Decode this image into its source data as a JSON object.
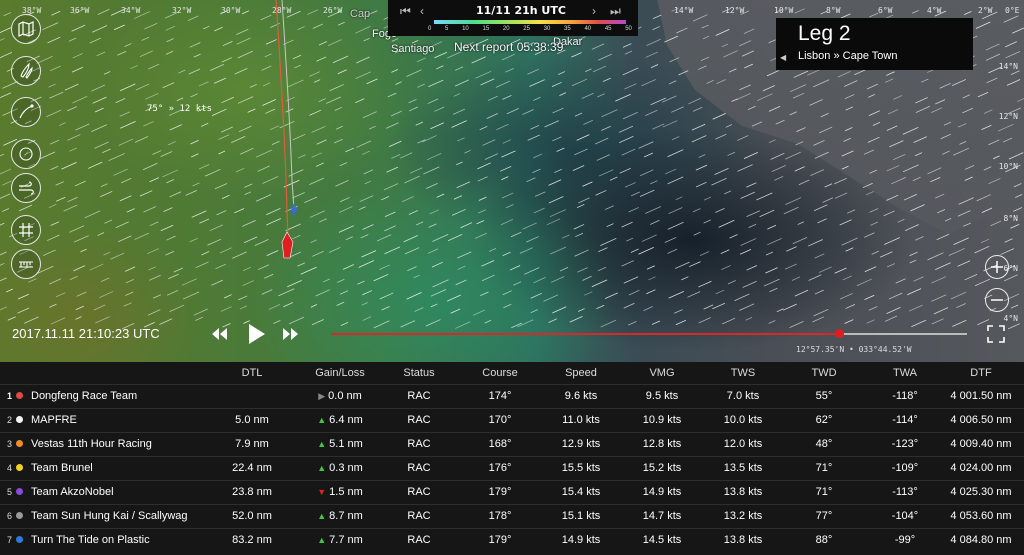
{
  "map": {
    "timebar": {
      "time": "11/11 21h UTC",
      "scale_ticks": [
        "0",
        "5",
        "10",
        "15",
        "20",
        "25",
        "30",
        "35",
        "40",
        "45",
        "50"
      ]
    },
    "places": [
      "Cap",
      "Fogo",
      "Santiago",
      "Dakar"
    ],
    "next_report": "Next report 05:38:39",
    "wind_label": "75° » 12 kts",
    "lon_labels": [
      "38°W",
      "36°W",
      "34°W",
      "32°W",
      "30°W",
      "28°W",
      "26°W",
      "14°W",
      "12°W",
      "10°W",
      "8°W",
      "6°W",
      "4°W",
      "2°W",
      "0°E"
    ],
    "lat_labels": [
      "14°N",
      "12°N",
      "10°N",
      "8°N",
      "6°N",
      "4°N"
    ],
    "leg": {
      "title": "Leg 2",
      "route": "Lisbon » Cape Town"
    },
    "tools": [
      "layers-icon",
      "sail-icon",
      "route-icon",
      "compass-icon",
      "wind-icon",
      "grid-icon",
      "ruler-icon"
    ],
    "timestamp": "2017.11.11 21:10:23 UTC",
    "timeline_progress": 0.8,
    "coords": "12°57.35'N • 033°44.52'W"
  },
  "table": {
    "headers": [
      "DTL",
      "Gain/Loss",
      "Status",
      "Course",
      "Speed",
      "VMG",
      "TWS",
      "TWD",
      "TWA",
      "DTF"
    ],
    "rows": [
      {
        "rank": "1",
        "color": "#e04848",
        "team": "Dongfeng Race Team",
        "dtl": "",
        "trend": "right",
        "gain": "0.0 nm",
        "status": "RAC",
        "course": "174°",
        "speed": "9.6 kts",
        "vmg": "9.5 kts",
        "tws": "7.0 kts",
        "twd": "55°",
        "twa": "-118°",
        "dtf": "4 001.50 nm"
      },
      {
        "rank": "2",
        "color": "#f4f4f4",
        "team": "MAPFRE",
        "dtl": "5.0 nm",
        "trend": "up",
        "gain": "6.4 nm",
        "status": "RAC",
        "course": "170°",
        "speed": "11.0 kts",
        "vmg": "10.9 kts",
        "tws": "10.0 kts",
        "twd": "62°",
        "twa": "-114°",
        "dtf": "4 006.50 nm"
      },
      {
        "rank": "3",
        "color": "#f08a2a",
        "team": "Vestas 11th Hour Racing",
        "dtl": "7.9 nm",
        "trend": "up",
        "gain": "5.1 nm",
        "status": "RAC",
        "course": "168°",
        "speed": "12.9 kts",
        "vmg": "12.8 kts",
        "tws": "12.0 kts",
        "twd": "48°",
        "twa": "-123°",
        "dtf": "4 009.40 nm"
      },
      {
        "rank": "4",
        "color": "#f4d020",
        "team": "Team Brunel",
        "dtl": "22.4 nm",
        "trend": "up",
        "gain": "0.3 nm",
        "status": "RAC",
        "course": "176°",
        "speed": "15.5 kts",
        "vmg": "15.2 kts",
        "tws": "13.5 kts",
        "twd": "71°",
        "twa": "-109°",
        "dtf": "4 024.00 nm"
      },
      {
        "rank": "5",
        "color": "#8a4ad8",
        "team": "Team AkzoNobel",
        "dtl": "23.8 nm",
        "trend": "down",
        "gain": "1.5 nm",
        "status": "RAC",
        "course": "179°",
        "speed": "15.4 kts",
        "vmg": "14.9 kts",
        "tws": "13.8 kts",
        "twd": "71°",
        "twa": "-113°",
        "dtf": "4 025.30 nm"
      },
      {
        "rank": "6",
        "color": "#9a9a9a",
        "team": "Team Sun Hung Kai / Scallywag",
        "dtl": "52.0 nm",
        "trend": "up",
        "gain": "8.7 nm",
        "status": "RAC",
        "course": "178°",
        "speed": "15.1 kts",
        "vmg": "14.7 kts",
        "tws": "13.2 kts",
        "twd": "77°",
        "twa": "-104°",
        "dtf": "4 053.60 nm"
      },
      {
        "rank": "7",
        "color": "#2a7ae0",
        "team": "Turn The Tide on Plastic",
        "dtl": "83.2 nm",
        "trend": "up",
        "gain": "7.7 nm",
        "status": "RAC",
        "course": "179°",
        "speed": "14.9 kts",
        "vmg": "14.5 kts",
        "tws": "13.8 kts",
        "twd": "88°",
        "twa": "-99°",
        "dtf": "4 084.80 nm"
      }
    ]
  }
}
